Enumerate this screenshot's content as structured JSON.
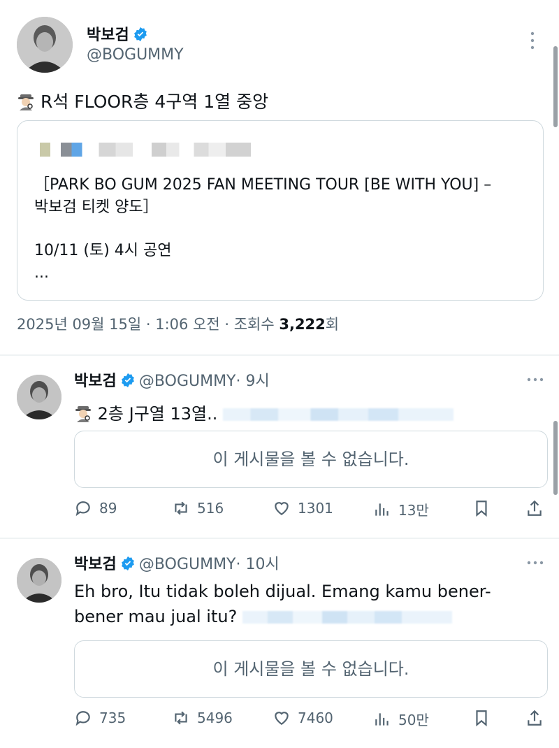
{
  "main_tweet": {
    "name": "박보검",
    "handle": "@BOGUMMY",
    "text": "R석 FLOOR층 4구역 1열 중앙",
    "quote": {
      "line1": "［PARK BO GUM 2025 FAN MEETING TOUR [BE WITH YOU] –",
      "line2": "박보검 티켓 양도］",
      "line3": "10/11 (토) 4시 공연",
      "line4": "..."
    },
    "meta_date": "2025년 09월 15일 · 1:06 오전 · 조회수 ",
    "meta_views": "3,222",
    "meta_suffix": "회"
  },
  "reply1": {
    "name": "박보검",
    "handle": "@BOGUMMY",
    "time": "· 9시",
    "text": "2층 J구열 13열..",
    "unavailable": "이 게시물을 볼 수 없습니다.",
    "replies": "89",
    "retweets": "516",
    "likes": "1301",
    "views": "13만"
  },
  "reply2": {
    "name": "박보검",
    "handle": "@BOGUMMY",
    "time": "· 10시",
    "text_line1": "Eh bro, Itu tidak boleh dijual. Emang kamu bener-",
    "text_line2": "bener mau jual itu?",
    "unavailable": "이 게시물을 볼 수 없습니다.",
    "replies": "735",
    "retweets": "5496",
    "likes": "7460",
    "views": "50만"
  },
  "colors": {
    "verified": "#1d9bf0",
    "secondary_text": "#536471",
    "border": "#cfd9de"
  },
  "icons": [
    "verified-icon",
    "more-icon",
    "detective-emoji",
    "reply-icon",
    "retweet-icon",
    "like-icon",
    "views-icon",
    "bookmark-icon",
    "share-icon"
  ]
}
